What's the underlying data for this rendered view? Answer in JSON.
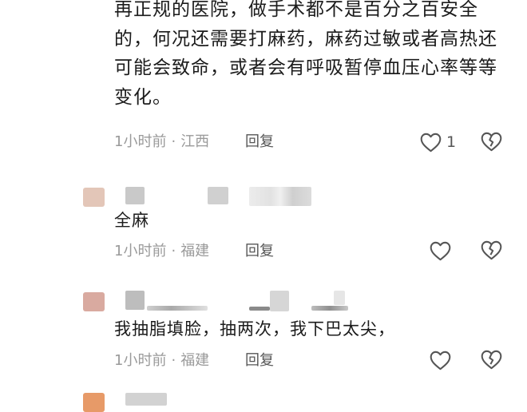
{
  "comments": [
    {
      "text": "再正规的医院，做手术都不是百分之百安全的，何况还需要打麻药，麻药过敏或者高热还可能会致命，或者会有呼吸暂停血压心率等等变化。",
      "time": "1小时前",
      "location": "江西",
      "reply_label": "回复",
      "likes": "1",
      "avatar_color": "#e8cfc3"
    },
    {
      "text": "全麻",
      "time": "1小时前",
      "location": "福建",
      "reply_label": "回复",
      "likes": "",
      "avatar_color": "#e3c6b8"
    },
    {
      "text": "我抽脂填脸，抽两次，我下巴太尖，",
      "time": "1小时前",
      "location": "福建",
      "reply_label": "回复",
      "likes": "",
      "avatar_color": "#d9aaa0"
    },
    {
      "avatar_color": "#e79a68"
    }
  ],
  "separator": "·",
  "icons": {
    "like": "heart-outline-icon",
    "dislike": "broken-heart-icon"
  },
  "colors": {
    "text": "#1b1b1b",
    "meta": "#9a9a9a",
    "icon": "#555555"
  }
}
